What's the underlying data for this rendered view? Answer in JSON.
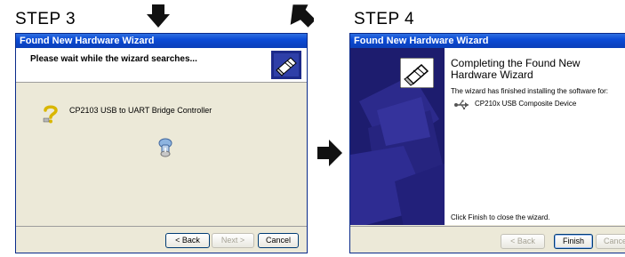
{
  "step3": {
    "label": "STEP 3",
    "window_title": "Found New Hardware Wizard",
    "header": "Please wait while the wizard searches...",
    "device_name": "CP2103 USB to UART Bridge Controller",
    "buttons": {
      "back": "< Back",
      "next": "Next >",
      "cancel": "Cancel"
    }
  },
  "step4": {
    "label": "STEP 4",
    "window_title": "Found New Hardware Wizard",
    "heading": "Completing the Found New Hardware Wizard",
    "heading_line1": "Completing the Found New",
    "heading_line2": "Hardware Wizard",
    "finished_text": "The wizard has finished installing the software for:",
    "device_name": "CP210x USB Composite Device",
    "close_text": "Click Finish to close the wizard.",
    "buttons": {
      "back": "< Back",
      "finish": "Finish",
      "cancel": "Cancel"
    }
  },
  "colors": {
    "titlebar": "#0b4bd6",
    "window_bg": "#ece9d8",
    "banner_dark": "#1d1c6e",
    "arrow": "#111111"
  },
  "icons": {
    "arrows": [
      "down-arrow-icon",
      "diagonal-arrow-icon",
      "right-arrow-icon"
    ],
    "wizard": "hardware-wizard-icon",
    "question": "question-mark-icon",
    "search": "search-flashlight-icon",
    "usb": "usb-icon"
  }
}
